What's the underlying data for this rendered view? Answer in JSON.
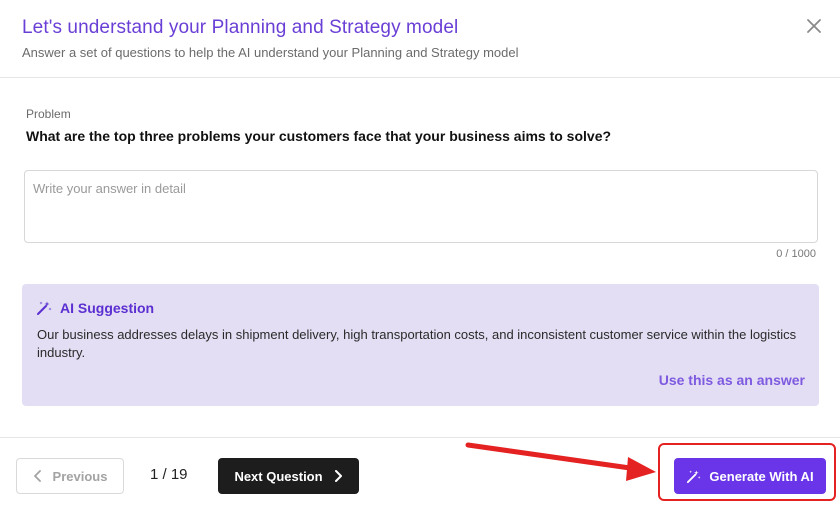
{
  "header": {
    "title": "Let's understand your Planning and Strategy model",
    "subtitle": "Answer a set of questions to help the AI understand your Planning and Strategy model",
    "close_icon": "close-icon"
  },
  "question": {
    "category": "Problem",
    "text": "What are the top three problems your customers face that your business aims to solve?",
    "answer_placeholder": "Write your answer in detail",
    "answer_value": "",
    "char_counter": "0 / 1000"
  },
  "suggestion": {
    "icon": "magic-wand-icon",
    "title": "AI Suggestion",
    "body": "Our business addresses delays in shipment delivery, high transportation costs, and inconsistent customer service within the logistics industry.",
    "use_label": "Use this as an answer"
  },
  "footer": {
    "previous_label": "Previous",
    "page_indicator": "1 / 19",
    "next_label": "Next Question",
    "generate_label": "Generate With AI"
  },
  "colors": {
    "accent": "#6a35e8",
    "title": "#6a3fd6",
    "suggestion_bg": "#e3def3",
    "next_button_bg": "#1d1d1d",
    "annotation": "#e52222"
  }
}
